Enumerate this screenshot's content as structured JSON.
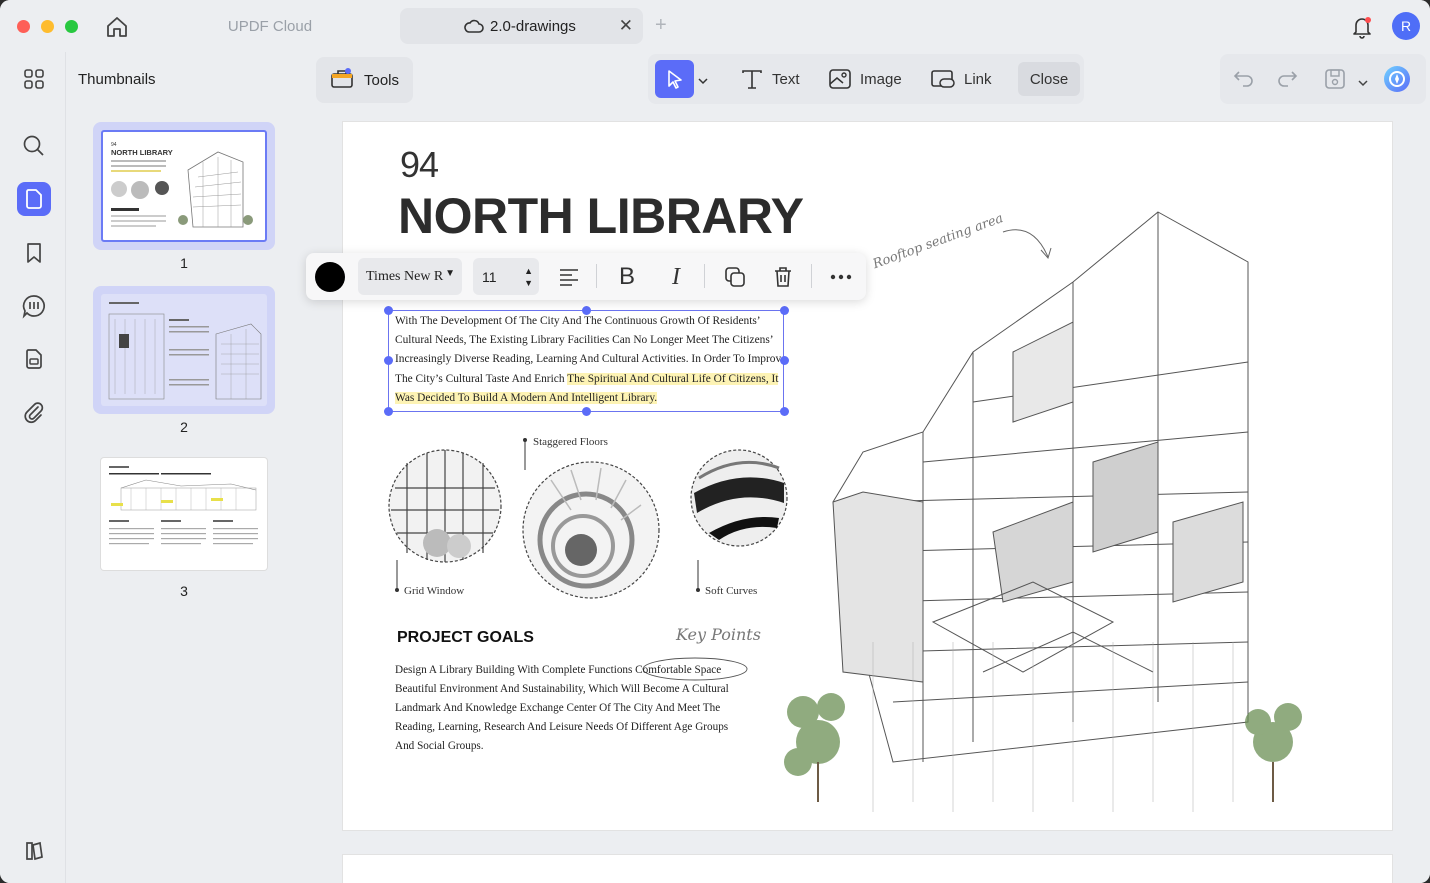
{
  "titlebar": {
    "tabs": [
      {
        "label": "UPDF Cloud"
      },
      {
        "label": "2.0-drawings"
      }
    ],
    "avatar_initial": "R"
  },
  "sidebar": {
    "panel_title": "Thumbnails",
    "rail_icons": [
      "thumbnails-icon",
      "search-icon",
      "pages-icon",
      "bookmark-icon",
      "comments-icon",
      "forms-icon",
      "attachment-icon",
      "layers-icon"
    ],
    "pages": [
      "1",
      "2",
      "3"
    ]
  },
  "toolbar": {
    "tools_label": "Tools",
    "text_label": "Text",
    "image_label": "Image",
    "link_label": "Link",
    "close_label": "Close"
  },
  "format_bar": {
    "font": "Times New R",
    "size": "11",
    "color": "#000000"
  },
  "page": {
    "number": "94",
    "title": "NORTH LIBRARY",
    "body_lines": [
      "With The Development Of The City And The Continuous Growth Of Residents’",
      "Cultural Needs, The Existing Library Facilities Can No Longer Meet The Citizens’",
      "Increasingly Diverse Reading, Learning And Cultural Activities. In Order To Improve",
      "The City’s Cultural Taste And Enrich ",
      "The Spiritual And Cultural Life Of Citizens, It",
      "Was Decided To Build A Modern And Intelligent Library."
    ],
    "labels": {
      "staggered": "Staggered Floors",
      "grid": "Grid Window",
      "soft": "Soft Curves",
      "rooftop": "Rooftop seating area",
      "keypoints": "Key Points"
    },
    "goals_title": "PROJECT GOALS",
    "goals_lines": [
      "Design A Library Building With Complete Functions Comfortable Space",
      "Beautiful Environment And Sustainability, Which Will Become A Cultural",
      "Landmark And Knowledge Exchange Center Of The City And Meet The",
      "Reading, Learning, Research And Leisure Needs Of Different Age Groups",
      "And Social Groups."
    ]
  },
  "colors": {
    "accent": "#5b6cf8",
    "highlight": "#fdf3b4",
    "avatar": "#4f6ef7"
  }
}
